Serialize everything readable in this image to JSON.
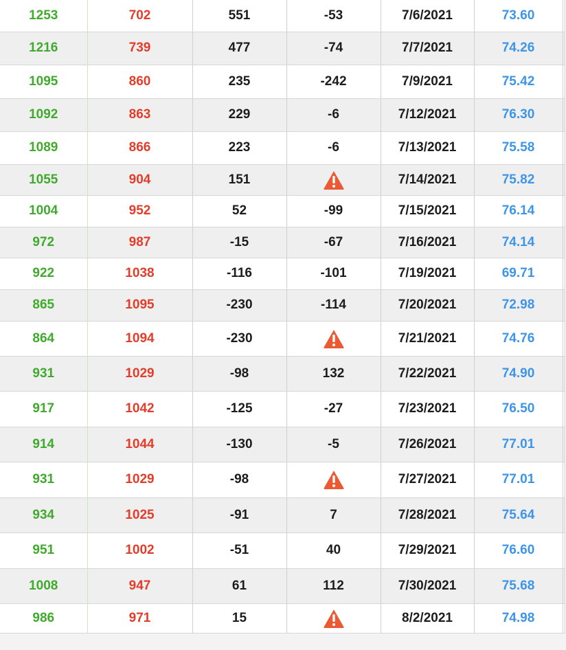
{
  "colors": {
    "positive": "#3faa2c",
    "negative": "#e23d2a",
    "neutral": "#1c1c1c",
    "price": "#3d95e8",
    "warning": "#ea5a35"
  },
  "rows": [
    {
      "c1": "1253",
      "c2": "702",
      "c3": "551",
      "c4": "-53",
      "date": "7/6/2021",
      "price": "73.60",
      "warn": false
    },
    {
      "c1": "1216",
      "c2": "739",
      "c3": "477",
      "c4": "-74",
      "date": "7/7/2021",
      "price": "74.26",
      "warn": false
    },
    {
      "c1": "1095",
      "c2": "860",
      "c3": "235",
      "c4": "-242",
      "date": "7/9/2021",
      "price": "75.42",
      "warn": false
    },
    {
      "c1": "1092",
      "c2": "863",
      "c3": "229",
      "c4": "-6",
      "date": "7/12/2021",
      "price": "76.30",
      "warn": false
    },
    {
      "c1": "1089",
      "c2": "866",
      "c3": "223",
      "c4": "-6",
      "date": "7/13/2021",
      "price": "75.58",
      "warn": false
    },
    {
      "c1": "1055",
      "c2": "904",
      "c3": "151",
      "c4": "",
      "date": "7/14/2021",
      "price": "75.82",
      "warn": true
    },
    {
      "c1": "1004",
      "c2": "952",
      "c3": "52",
      "c4": "-99",
      "date": "7/15/2021",
      "price": "76.14",
      "warn": false
    },
    {
      "c1": "972",
      "c2": "987",
      "c3": "-15",
      "c4": "-67",
      "date": "7/16/2021",
      "price": "74.14",
      "warn": false
    },
    {
      "c1": "922",
      "c2": "1038",
      "c3": "-116",
      "c4": "-101",
      "date": "7/19/2021",
      "price": "69.71",
      "warn": false
    },
    {
      "c1": "865",
      "c2": "1095",
      "c3": "-230",
      "c4": "-114",
      "date": "7/20/2021",
      "price": "72.98",
      "warn": false
    },
    {
      "c1": "864",
      "c2": "1094",
      "c3": "-230",
      "c4": "",
      "date": "7/21/2021",
      "price": "74.76",
      "warn": true
    },
    {
      "c1": "931",
      "c2": "1029",
      "c3": "-98",
      "c4": "132",
      "date": "7/22/2021",
      "price": "74.90",
      "warn": false
    },
    {
      "c1": "917",
      "c2": "1042",
      "c3": "-125",
      "c4": "-27",
      "date": "7/23/2021",
      "price": "76.50",
      "warn": false
    },
    {
      "c1": "914",
      "c2": "1044",
      "c3": "-130",
      "c4": "-5",
      "date": "7/26/2021",
      "price": "77.01",
      "warn": false
    },
    {
      "c1": "931",
      "c2": "1029",
      "c3": "-98",
      "c4": "",
      "date": "7/27/2021",
      "price": "77.01",
      "warn": true
    },
    {
      "c1": "934",
      "c2": "1025",
      "c3": "-91",
      "c4": "7",
      "date": "7/28/2021",
      "price": "75.64",
      "warn": false
    },
    {
      "c1": "951",
      "c2": "1002",
      "c3": "-51",
      "c4": "40",
      "date": "7/29/2021",
      "price": "76.60",
      "warn": false
    },
    {
      "c1": "1008",
      "c2": "947",
      "c3": "61",
      "c4": "112",
      "date": "7/30/2021",
      "price": "75.68",
      "warn": false
    },
    {
      "c1": "986",
      "c2": "971",
      "c3": "15",
      "c4": "",
      "date": "8/2/2021",
      "price": "74.98",
      "warn": true
    }
  ]
}
